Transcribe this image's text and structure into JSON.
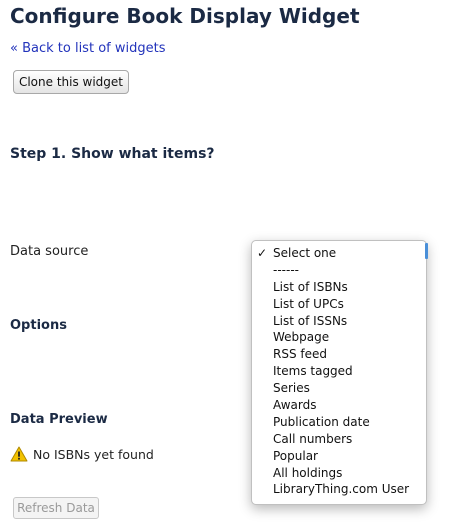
{
  "header": {
    "title": "Configure Book Display Widget",
    "back_link": "« Back to list of widgets",
    "clone_button": "Clone this widget"
  },
  "step1": {
    "heading": "Step 1. Show what items?",
    "data_source_label": "Data source"
  },
  "data_source_select": {
    "selected": "Select one",
    "options": [
      "Select one",
      "------",
      "List of ISBNs",
      "List of UPCs",
      "List of ISSNs",
      "Webpage",
      "RSS feed",
      "Items tagged",
      "Series",
      "Awards",
      "Publication date",
      "Call numbers",
      "Popular",
      "All holdings",
      "LibraryThing.com User"
    ]
  },
  "options_section": {
    "heading": "Options"
  },
  "preview": {
    "heading": "Data Preview",
    "warning_text": "No ISBNs yet found",
    "refresh_button": "Refresh Data"
  },
  "icons": {
    "warning": "warning-triangle-icon",
    "check": "checkmark-icon"
  },
  "colors": {
    "link": "#2233bb",
    "heading": "#1b2a44",
    "warning": "#f2c200",
    "focus": "#4a8fd8"
  }
}
